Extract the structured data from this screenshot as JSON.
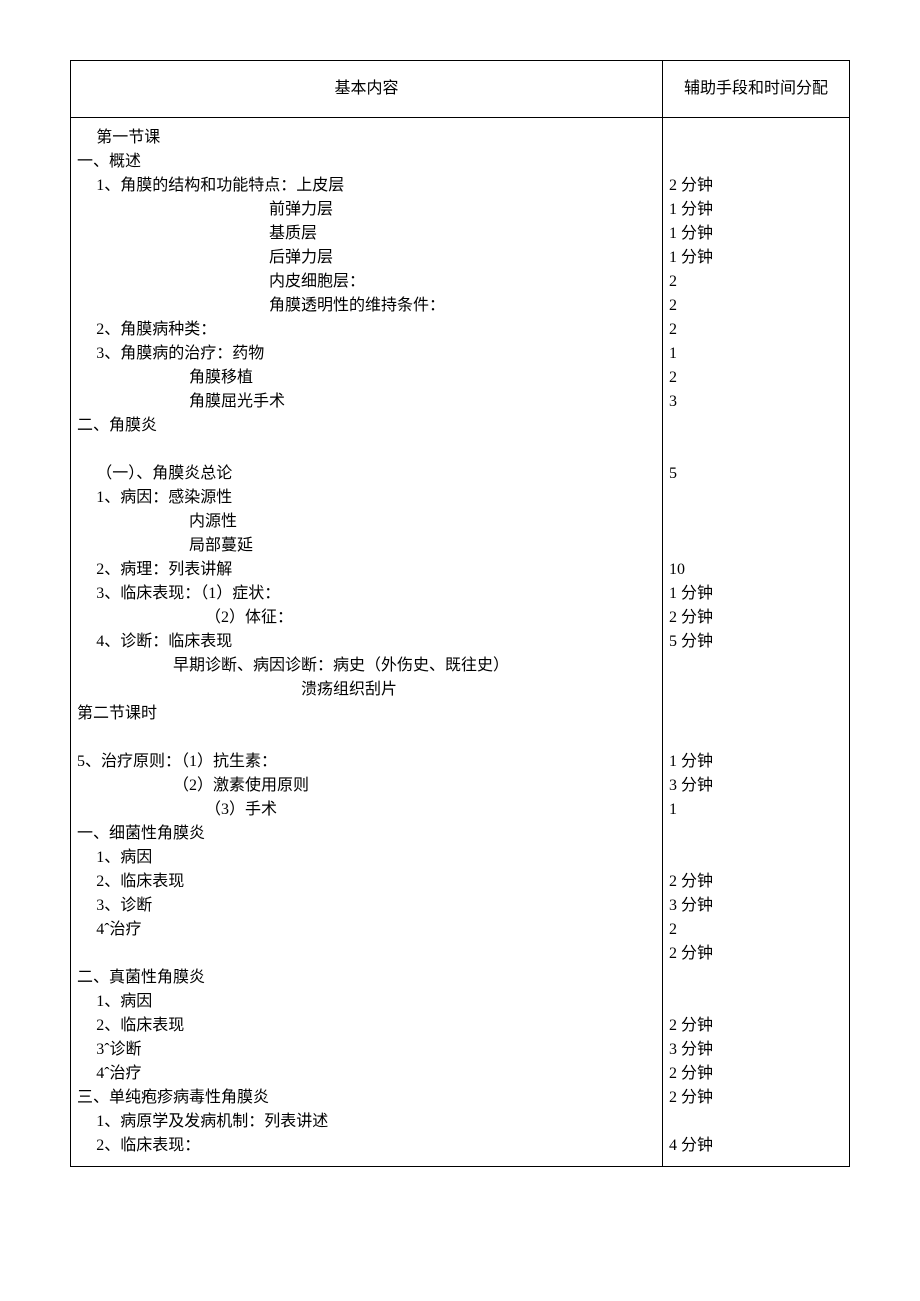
{
  "header": {
    "main": "基本内容",
    "side": "辅助手段和时间分配"
  },
  "rows": [
    {
      "t": "第一节课",
      "cls": "i1"
    },
    {
      "t": "一、概述"
    },
    {
      "t": "1、角膜的结构和功能特点：上皮层",
      "cls": "i1",
      "d": "2 分钟"
    },
    {
      "t": "前弹力层",
      "cls": "i2",
      "d": "1 分钟"
    },
    {
      "t": "基质层",
      "cls": "i2",
      "d": "1 分钟"
    },
    {
      "t": "后弹力层",
      "cls": "i2",
      "d": "1 分钟"
    },
    {
      "t": "内皮细胞层：",
      "cls": "i2",
      "d": "2"
    },
    {
      "t": "角膜透明性的维持条件：",
      "cls": "i2",
      "d": "2"
    },
    {
      "t": "2、角膜病种类：",
      "cls": "i1",
      "d": "2"
    },
    {
      "t": "3、角膜病的治疗：药物",
      "cls": "i1",
      "d": "1"
    },
    {
      "t": "角膜移植",
      "cls": "i3",
      "d": "2"
    },
    {
      "t": "角膜屈光手术",
      "cls": "i3",
      "d": "3"
    },
    {
      "t": "二、角膜炎"
    },
    {
      "gap": true
    },
    {
      "t": "（一）、角膜炎总论",
      "cls": "i1",
      "d": "5"
    },
    {
      "t": "1、病因：感染源性",
      "cls": "i1"
    },
    {
      "t": "内源性",
      "cls": "i3"
    },
    {
      "t": "局部蔓延",
      "cls": "i3"
    },
    {
      "t": "2、病理：列表讲解",
      "cls": "i1",
      "d": "10"
    },
    {
      "t": "3、临床表现：（1）症状：",
      "cls": "i1",
      "d": "1 分钟"
    },
    {
      "t": "（2）体征：",
      "cls": "i5",
      "d": "2 分钟"
    },
    {
      "t": "4、诊断：临床表现",
      "cls": "i1",
      "d": "5 分钟"
    },
    {
      "t": "早期诊断、病因诊断：病史（外伤史、既往史）",
      "cls": "i7"
    },
    {
      "t": "溃疡组织刮片",
      "cls": "i6"
    },
    {
      "t": "第二节课时"
    },
    {
      "gap2": true
    },
    {
      "t": "5、治疗原则：（1）抗生素：",
      "d": "1 分钟"
    },
    {
      "t": "（2）激素使用原则",
      "cls": "i7",
      "d": "3 分钟"
    },
    {
      "t": "（3）手术",
      "cls": "i5",
      "d": "1"
    },
    {
      "t": "一、细菌性角膜炎"
    },
    {
      "t": "1、病因",
      "cls": "i1"
    },
    {
      "t": "2、临床表现",
      "cls": "i1",
      "d": "2 分钟"
    },
    {
      "t": "3、诊断",
      "cls": "i1",
      "d": "3 分钟"
    },
    {
      "t": "4ˆ治疗",
      "cls": "i1",
      "d": "2"
    },
    {
      "t": "",
      "d": "2 分钟"
    },
    {
      "t": "二、真菌性角膜炎"
    },
    {
      "t": "1、病因",
      "cls": "i1"
    },
    {
      "t": "2、临床表现",
      "cls": "i1",
      "d": "2 分钟"
    },
    {
      "t": "3ˆ诊断",
      "cls": "i1",
      "d": "3 分钟"
    },
    {
      "t": "4ˆ治疗",
      "cls": "i1",
      "d": "2 分钟"
    },
    {
      "t": "三、单纯疱疹病毒性角膜炎",
      "d": "2 分钟"
    },
    {
      "t": "1、病原学及发病机制：列表讲述",
      "cls": "i1"
    },
    {
      "t": "2、临床表现：",
      "cls": "i1",
      "d": "4 分钟"
    }
  ]
}
